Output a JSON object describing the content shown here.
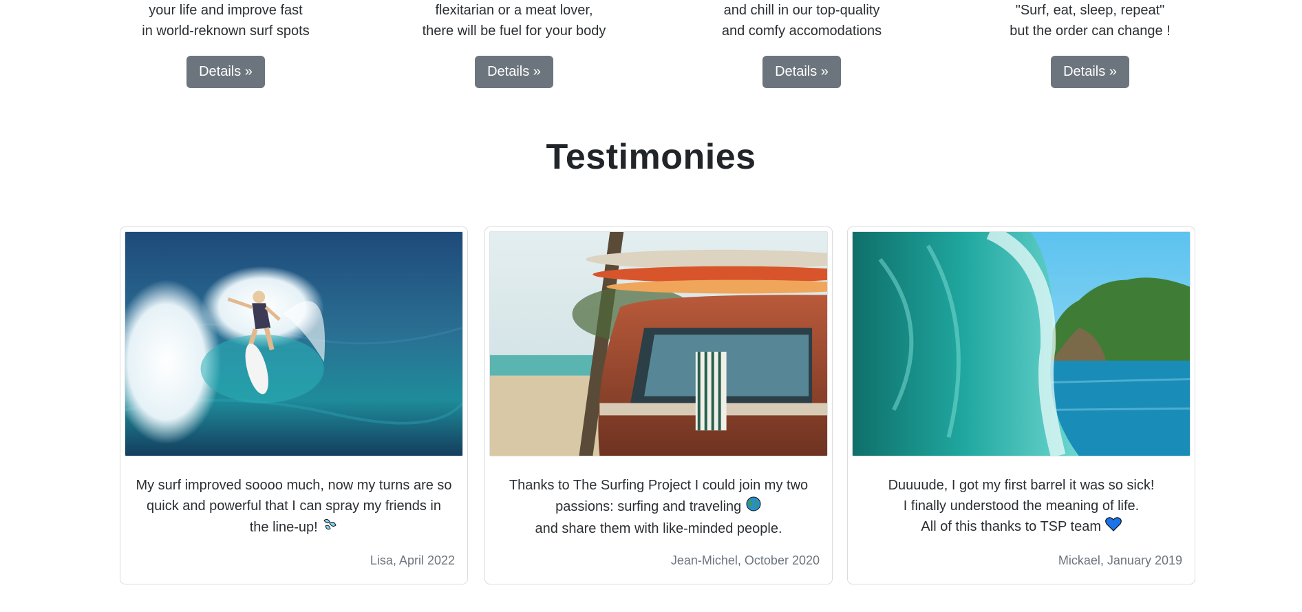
{
  "features": [
    {
      "line1": "your life and improve fast",
      "line2": "in world-reknown surf spots",
      "button": "Details »"
    },
    {
      "line1": "flexitarian or a meat lover,",
      "line2": "there will be fuel for your body",
      "button": "Details »"
    },
    {
      "line1": "and chill in our top-quality",
      "line2": "and comfy accomodations",
      "button": "Details »"
    },
    {
      "line1": "\"Surf, eat, sleep, repeat\"",
      "line2": "but the order can change !",
      "button": "Details »"
    }
  ],
  "section_title": "Testimonies",
  "testimonies": [
    {
      "lines": [
        "My surf improved soooo much, now my turns are so",
        "quick and powerful that I can spray my friends in",
        "the line-up!"
      ],
      "emoji": "droplets-icon",
      "author": "Lisa, April 2022"
    },
    {
      "lines": [
        "Thanks to The Surfing Project I could join my two",
        "passions: surfing and traveling",
        "and share them with like-minded people."
      ],
      "emoji": "globe-icon",
      "author": "Jean-Michel, October 2020"
    },
    {
      "lines": [
        "Duuuude, I got my first barrel it was so sick!",
        "I finally understood the meaning of life.",
        "All of this thanks to TSP team"
      ],
      "emoji": "blue-heart-icon",
      "author": "Mickael, January 2019"
    }
  ],
  "colors": {
    "button_bg": "#6c757d",
    "heart": "#1a73e8"
  }
}
